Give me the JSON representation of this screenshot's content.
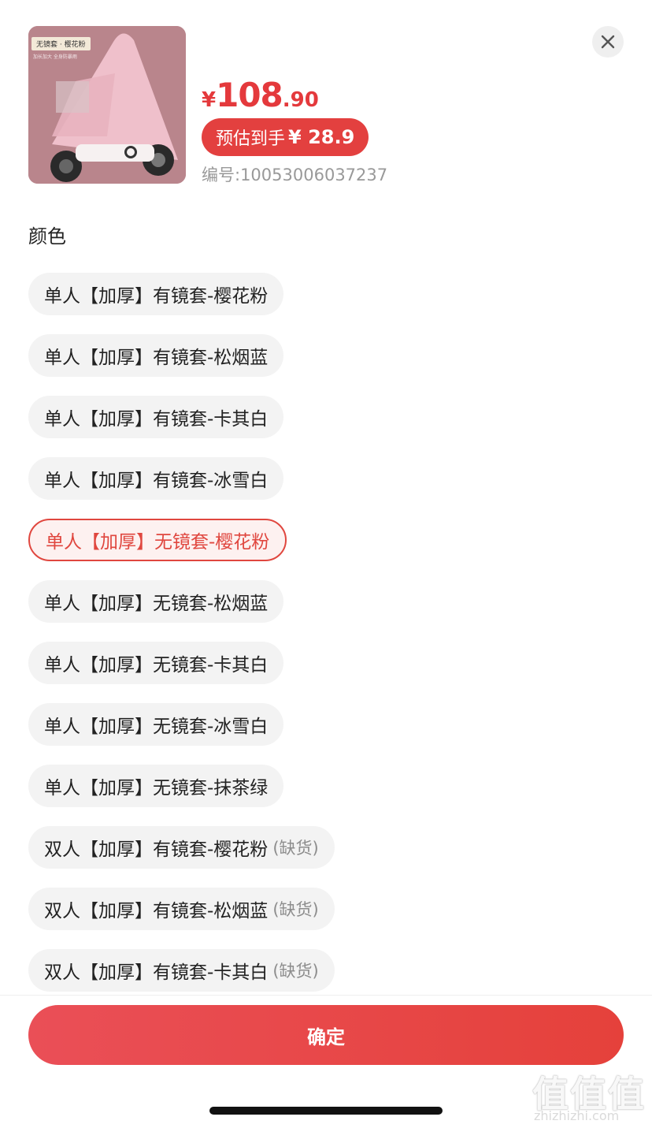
{
  "product": {
    "thumb_tag": "无镜套 · 樱花粉",
    "thumb_subtext": "加长加大 全身防暴雨",
    "price_symbol": "¥",
    "price_int": "108",
    "price_dec": ".90",
    "estimate_label": "预估到手",
    "estimate_value": "¥ 28.9",
    "sku": "编号:10053006037237"
  },
  "section": {
    "title": "颜色"
  },
  "options": [
    {
      "label": "单人【加厚】有镜套-樱花粉",
      "selected": false,
      "status": ""
    },
    {
      "label": "单人【加厚】有镜套-松烟蓝",
      "selected": false,
      "status": ""
    },
    {
      "label": "单人【加厚】有镜套-卡其白",
      "selected": false,
      "status": ""
    },
    {
      "label": "单人【加厚】有镜套-冰雪白",
      "selected": false,
      "status": ""
    },
    {
      "label": "单人【加厚】无镜套-樱花粉",
      "selected": true,
      "status": ""
    },
    {
      "label": "单人【加厚】无镜套-松烟蓝",
      "selected": false,
      "status": ""
    },
    {
      "label": "单人【加厚】无镜套-卡其白",
      "selected": false,
      "status": ""
    },
    {
      "label": "单人【加厚】无镜套-冰雪白",
      "selected": false,
      "status": ""
    },
    {
      "label": "单人【加厚】无镜套-抹茶绿",
      "selected": false,
      "status": ""
    },
    {
      "label": "双人【加厚】有镜套-樱花粉",
      "selected": false,
      "status": "(缺货)"
    },
    {
      "label": "双人【加厚】有镜套-松烟蓝",
      "selected": false,
      "status": "(缺货)"
    },
    {
      "label": "双人【加厚】有镜套-卡其白",
      "selected": false,
      "status": "(缺货)"
    }
  ],
  "footer": {
    "confirm_label": "确定"
  },
  "watermark": {
    "logo": "值值值",
    "url": "zhizhizhi.com"
  },
  "colors": {
    "accent": "#e4393c",
    "chip_bg": "#f3f3f3",
    "selected_bg": "#fdf1f0"
  },
  "icons": {
    "close": "close-icon"
  }
}
